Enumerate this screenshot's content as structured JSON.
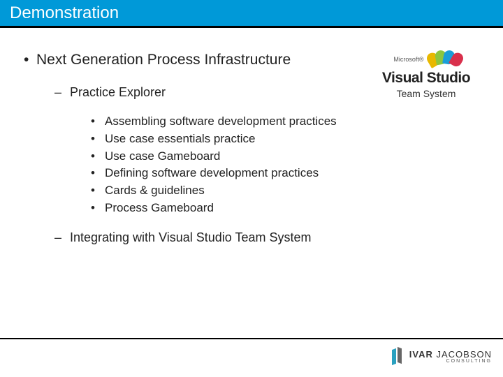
{
  "title": "Demonstration",
  "main": {
    "heading": "Next Generation Process Infrastructure",
    "sub": [
      {
        "label": "Practice Explorer",
        "items": [
          "Assembling software development practices",
          "Use case essentials practice",
          "Use case Gameboard",
          "Defining software development practices",
          "Cards & guidelines",
          "Process Gameboard"
        ]
      },
      {
        "label": "Integrating with Visual Studio Team System",
        "items": []
      }
    ]
  },
  "logo_right": {
    "vendor": "Microsoft®",
    "product": "Visual Studio",
    "subproduct": "Team System"
  },
  "footer_logo": {
    "first": "IVAR",
    "last": "JACOBSON",
    "tag": "CONSULTING"
  }
}
